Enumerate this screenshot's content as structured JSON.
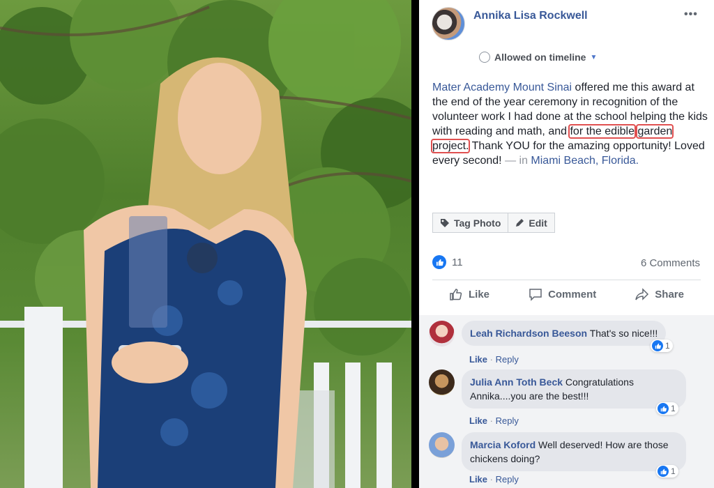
{
  "post": {
    "author": "Annika Lisa Rockwell",
    "more_icon": "•••",
    "privacy_label": "Allowed on timeline",
    "text": {
      "org_link": "Mater Academy Mount Sinai",
      "body_1": " offered me this award at the end of the year ceremony in recognition of the volunteer work I had done at the school helping the kids with reading and math, and ",
      "highlight_1": "for the edible",
      "space": " ",
      "highlight_2": "garden project.",
      "body_2": " Thank YOU for the amazing opportunity! Loved every second! ",
      "in_prefix": "— in ",
      "location_link": "Miami Beach, Florida."
    },
    "buttons": {
      "tag_photo": "Tag Photo",
      "edit": "Edit"
    },
    "like_count": "11",
    "comments_count": "6 Comments",
    "actions": {
      "like": "Like",
      "comment": "Comment",
      "share": "Share"
    }
  },
  "comments": [
    {
      "name": "Leah Richardson Beeson",
      "text": "That's so nice!!!",
      "reactions": "1",
      "like": "Like",
      "reply": "Reply",
      "sep": "·"
    },
    {
      "name": "Julia Ann Toth Beck",
      "text": "Congratulations Annika....you are the best!!!",
      "reactions": "1",
      "like": "Like",
      "reply": "Reply",
      "sep": "·"
    },
    {
      "name": "Marcia Koford",
      "text": "Well deserved! How are those chickens doing?",
      "reactions": "1",
      "like": "Like",
      "reply": "Reply",
      "sep": "·"
    }
  ],
  "colors": {
    "link": "#385898",
    "like_blue": "#1877f2",
    "highlight": "#e05050"
  }
}
